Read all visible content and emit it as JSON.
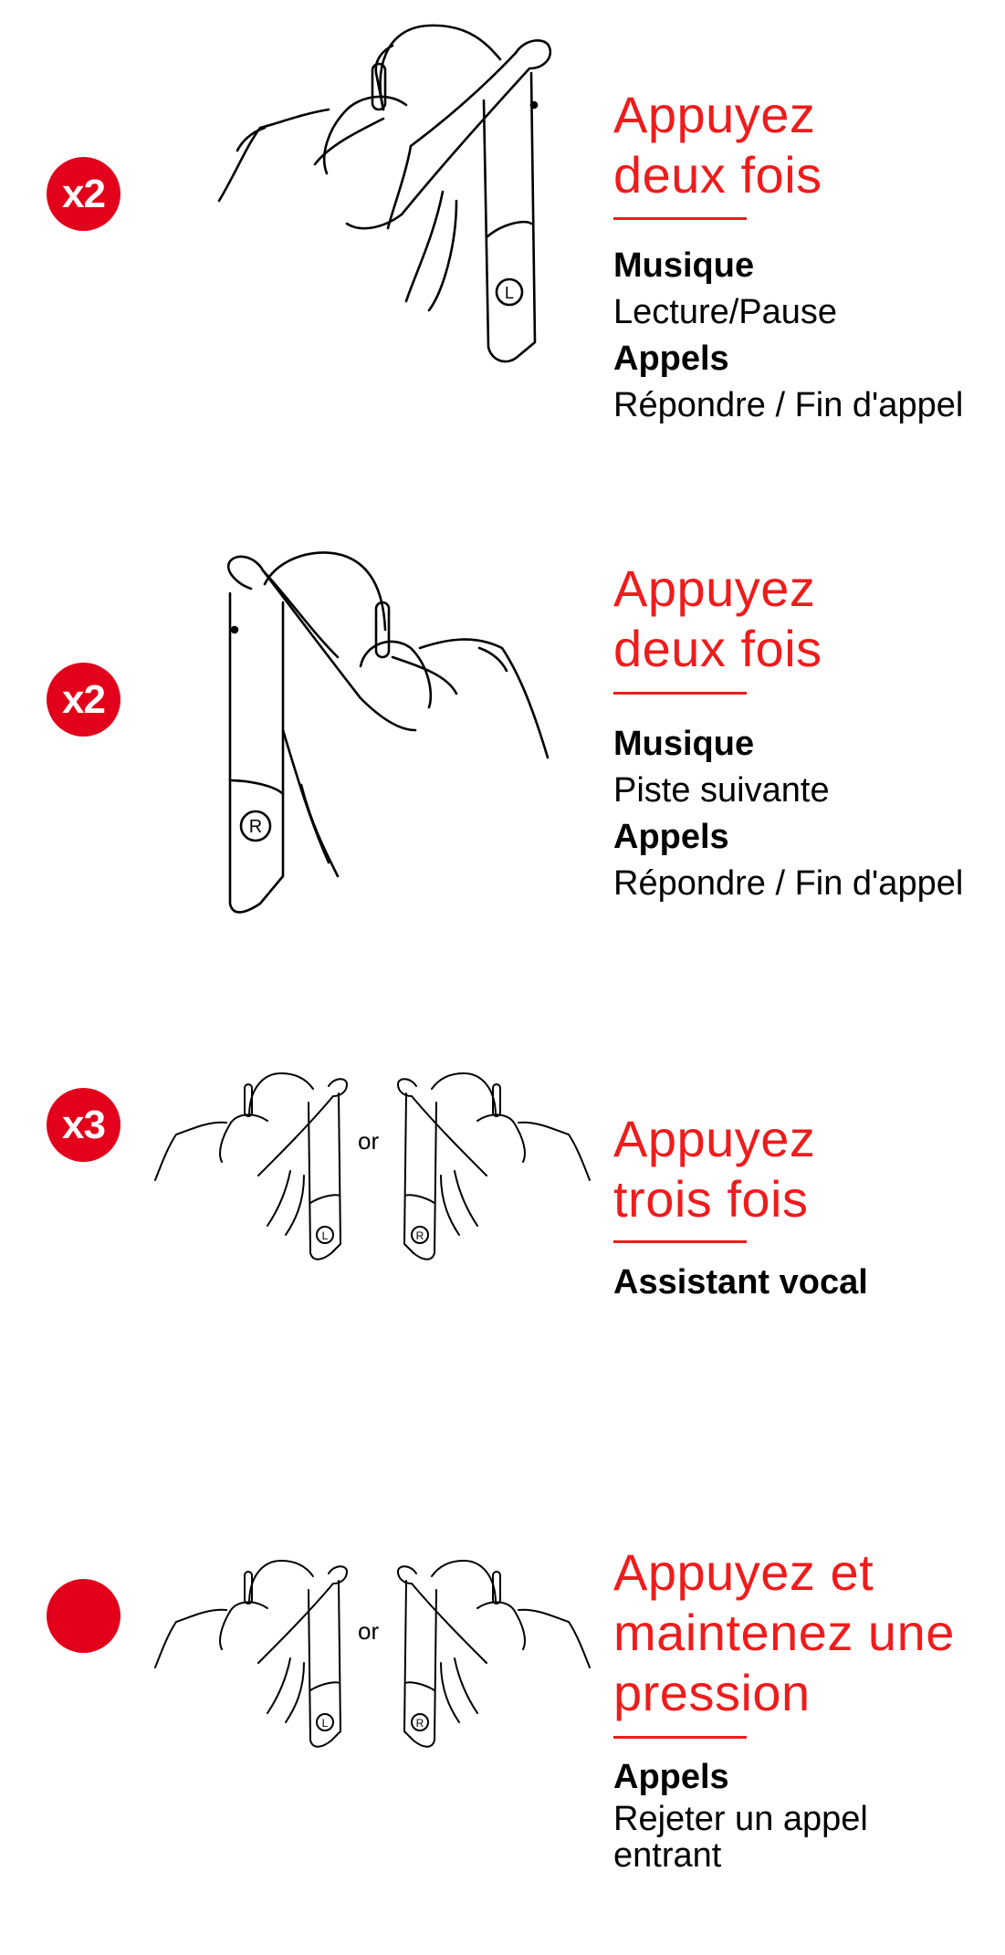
{
  "colors": {
    "accent": "#e2001a",
    "heading": "#ee1c1c"
  },
  "steps": [
    {
      "badge": "x2",
      "heading": [
        "Appuyez",
        "deux fois"
      ],
      "items": [
        {
          "label": "Musique",
          "value": "Lecture/Pause"
        },
        {
          "label": "Appels",
          "value": "Répondre / Fin d'appel"
        }
      ]
    },
    {
      "badge": "x2",
      "heading": [
        "Appuyez",
        "deux fois"
      ],
      "items": [
        {
          "label": "Musique",
          "value": "Piste suivante"
        },
        {
          "label": "Appels",
          "value": "Répondre / Fin d'appel"
        }
      ]
    },
    {
      "badge": "x3",
      "or": "or",
      "heading": [
        "Appuyez",
        "trois fois"
      ],
      "items": [
        {
          "label": "Assistant vocal"
        }
      ]
    },
    {
      "badge": "",
      "or": "or",
      "heading": [
        "Appuyez et",
        "maintenez une",
        "pression"
      ],
      "items": [
        {
          "label": "Appels",
          "value": "Rejeter un appel",
          "value_line2": "entrant"
        }
      ]
    }
  ]
}
